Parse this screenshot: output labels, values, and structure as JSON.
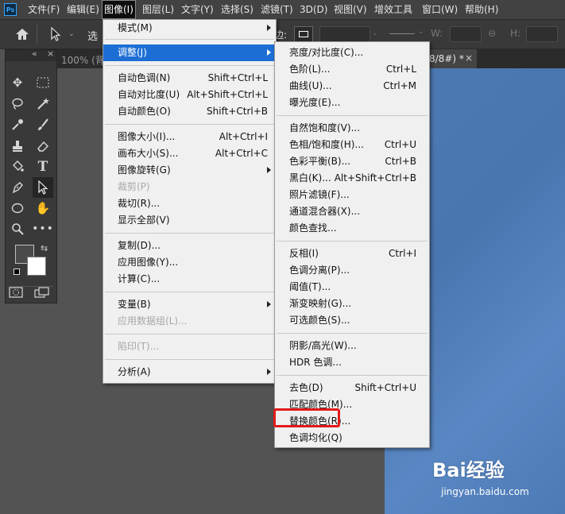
{
  "menubar": {
    "logo": "Ps",
    "items": [
      "文件(F)",
      "编辑(E)",
      "图像(I)",
      "图层(L)",
      "文字(Y)",
      "选择(S)",
      "滤镜(T)",
      "3D(D)",
      "视图(V)",
      "增效工具",
      "窗口(W)",
      "帮助(H)"
    ]
  },
  "options_bar": {
    "select_text": "选",
    "stroke_label": "边:",
    "w_label": "W:",
    "h_label": "H:"
  },
  "panel": {
    "collapse": "«",
    "close": "×"
  },
  "document": {
    "tab_left": "100% (背",
    "tab_right": "8/8#) *",
    "tab_close": "×"
  },
  "image_menu": {
    "items": [
      {
        "label": "模式(M)",
        "shortcut": "",
        "submenu": true,
        "disabled": false
      },
      {
        "label": "调整(J)",
        "shortcut": "",
        "submenu": true,
        "disabled": false,
        "highlighted": true
      },
      {
        "label": "自动色调(N)",
        "shortcut": "Shift+Ctrl+L",
        "disabled": false
      },
      {
        "label": "自动对比度(U)",
        "shortcut": "Alt+Shift+Ctrl+L",
        "disabled": false
      },
      {
        "label": "自动颜色(O)",
        "shortcut": "Shift+Ctrl+B",
        "disabled": false
      },
      {
        "label": "图像大小(I)...",
        "shortcut": "Alt+Ctrl+I",
        "disabled": false
      },
      {
        "label": "画布大小(S)...",
        "shortcut": "Alt+Ctrl+C",
        "disabled": false
      },
      {
        "label": "图像旋转(G)",
        "shortcut": "",
        "submenu": true,
        "disabled": false
      },
      {
        "label": "裁剪(P)",
        "shortcut": "",
        "disabled": true
      },
      {
        "label": "裁切(R)...",
        "shortcut": "",
        "disabled": false
      },
      {
        "label": "显示全部(V)",
        "shortcut": "",
        "disabled": false
      },
      {
        "label": "复制(D)...",
        "shortcut": "",
        "disabled": false
      },
      {
        "label": "应用图像(Y)...",
        "shortcut": "",
        "disabled": false
      },
      {
        "label": "计算(C)...",
        "shortcut": "",
        "disabled": false
      },
      {
        "label": "变量(B)",
        "shortcut": "",
        "submenu": true,
        "disabled": false
      },
      {
        "label": "应用数据组(L)...",
        "shortcut": "",
        "disabled": true
      },
      {
        "label": "陷印(T)...",
        "shortcut": "",
        "disabled": true
      },
      {
        "label": "分析(A)",
        "shortcut": "",
        "submenu": true,
        "disabled": false
      }
    ]
  },
  "adjust_menu": {
    "items": [
      {
        "label": "亮度/对比度(C)...",
        "shortcut": ""
      },
      {
        "label": "色阶(L)...",
        "shortcut": "Ctrl+L"
      },
      {
        "label": "曲线(U)...",
        "shortcut": "Ctrl+M"
      },
      {
        "label": "曝光度(E)...",
        "shortcut": ""
      },
      {
        "label": "自然饱和度(V)...",
        "shortcut": ""
      },
      {
        "label": "色相/饱和度(H)...",
        "shortcut": "Ctrl+U"
      },
      {
        "label": "色彩平衡(B)...",
        "shortcut": "Ctrl+B"
      },
      {
        "label": "黑白(K)...",
        "shortcut": "Alt+Shift+Ctrl+B"
      },
      {
        "label": "照片滤镜(F)...",
        "shortcut": ""
      },
      {
        "label": "通道混合器(X)...",
        "shortcut": ""
      },
      {
        "label": "颜色查找...",
        "shortcut": ""
      },
      {
        "label": "反相(I)",
        "shortcut": "Ctrl+I"
      },
      {
        "label": "色调分离(P)...",
        "shortcut": ""
      },
      {
        "label": "阈值(T)...",
        "shortcut": ""
      },
      {
        "label": "渐变映射(G)...",
        "shortcut": ""
      },
      {
        "label": "可选颜色(S)...",
        "shortcut": ""
      },
      {
        "label": "阴影/高光(W)...",
        "shortcut": ""
      },
      {
        "label": "HDR 色调...",
        "shortcut": ""
      },
      {
        "label": "去色(D)",
        "shortcut": "Shift+Ctrl+U"
      },
      {
        "label": "匹配颜色(M)...",
        "shortcut": ""
      },
      {
        "label": "替换颜色(R)...",
        "shortcut": "",
        "annotated": true
      },
      {
        "label": "色调均化(Q)",
        "shortcut": ""
      }
    ]
  },
  "watermark": {
    "logo_text": "Bai经验",
    "url": "jingyan.baidu.com"
  },
  "colors": {
    "menu_highlight": "#1c6ed5",
    "annotation_red": "#e21a1a",
    "canvas_blue": "#4d79b3"
  }
}
